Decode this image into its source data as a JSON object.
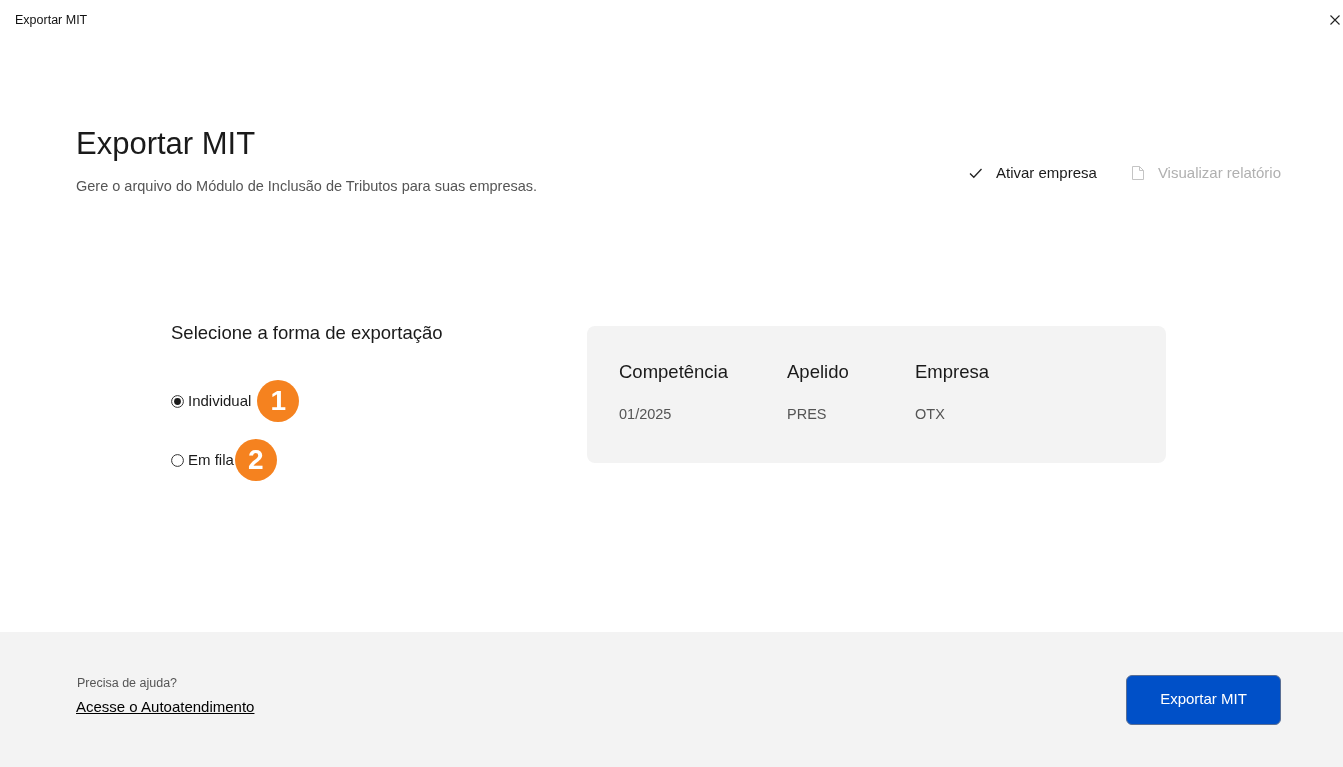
{
  "window": {
    "title": "Exportar MIT"
  },
  "header": {
    "title": "Exportar MIT",
    "subtitle": "Gere o arquivo do Módulo de Inclusão de Tributos para suas empresas."
  },
  "actions": [
    {
      "kind": "check",
      "label": "Ativar empresa",
      "disabled": false
    },
    {
      "kind": "document",
      "label": "Visualizar relatório",
      "disabled": true
    }
  ],
  "export_mode": {
    "heading": "Selecione a forma de exportação",
    "options": [
      {
        "label": "Individual",
        "selected": true,
        "marker": "1"
      },
      {
        "label": "Em fila",
        "selected": false,
        "marker": "2"
      }
    ]
  },
  "summary": {
    "columns": [
      {
        "header": "Competência",
        "value": "01/2025"
      },
      {
        "header": "Apelido",
        "value": "PRES"
      },
      {
        "header": "Empresa",
        "value": "OTX"
      }
    ]
  },
  "footer": {
    "help_text": "Precisa de ajuda?",
    "help_link": "Acesse o Autoatendimento",
    "primary_button": "Exportar MIT"
  }
}
